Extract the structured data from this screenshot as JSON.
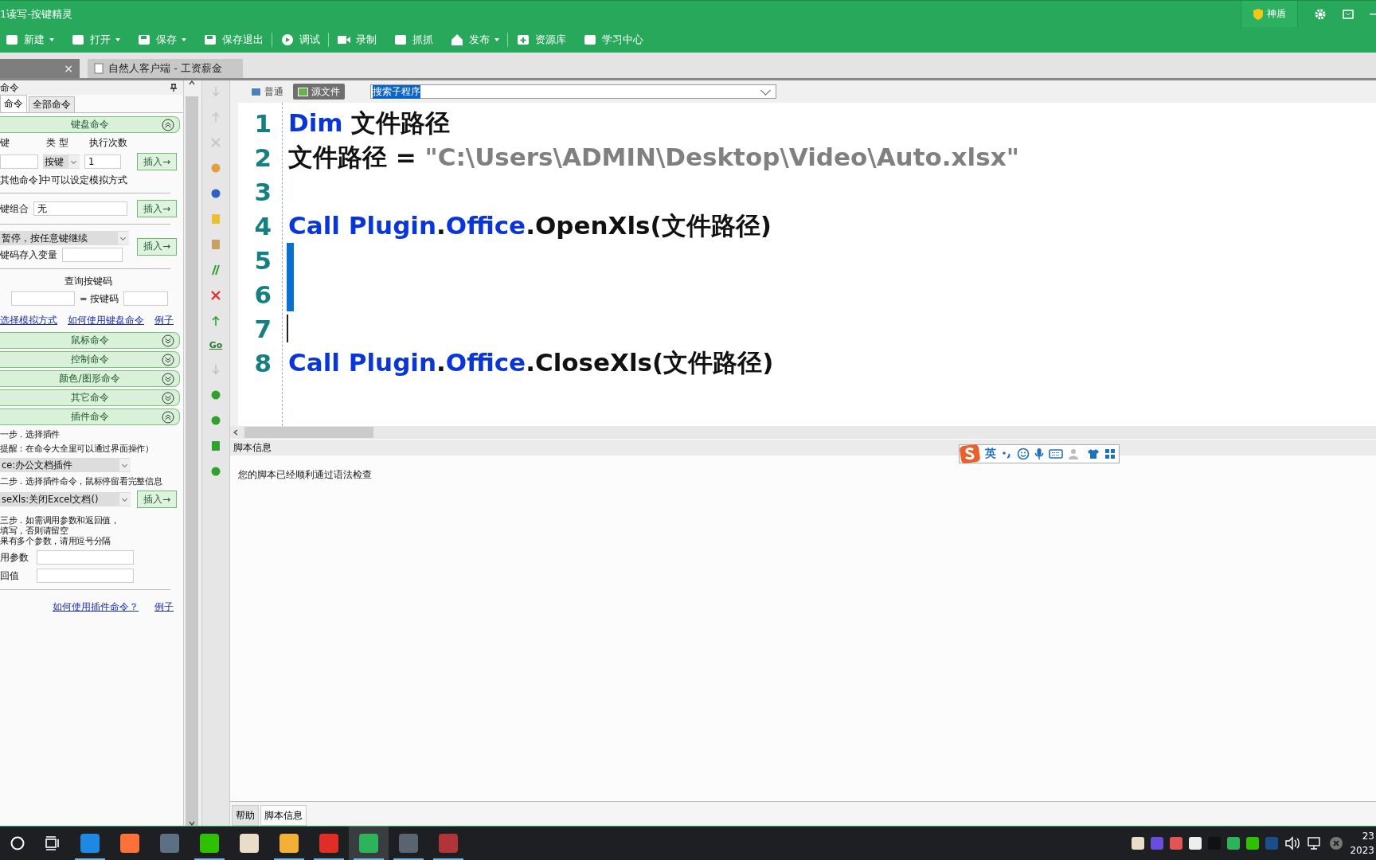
{
  "window": {
    "title": "1读写-按键精灵",
    "badge": "神盾"
  },
  "toolbar": [
    {
      "label": "新建",
      "dropdown": true,
      "separator_after": false
    },
    {
      "label": "打开",
      "dropdown": true,
      "separator_after": false
    },
    {
      "label": "保存",
      "dropdown": true,
      "separator_after": false
    },
    {
      "label": "保存退出",
      "dropdown": false,
      "separator_after": true
    },
    {
      "label": "调试",
      "dropdown": false,
      "separator_after": true
    },
    {
      "label": "录制",
      "dropdown": false,
      "separator_after": false
    },
    {
      "label": "抓抓",
      "dropdown": false,
      "separator_after": false
    },
    {
      "label": "发布",
      "dropdown": true,
      "separator_after": true
    },
    {
      "label": "资源库",
      "dropdown": false,
      "separator_after": false
    },
    {
      "label": "学习中心",
      "dropdown": false,
      "separator_after": false
    }
  ],
  "doc_tabs": [
    {
      "close": "×",
      "selected": true
    },
    {
      "label": "自然人客户端 - 工资薪金",
      "selected": false
    }
  ],
  "command_panel": {
    "title": "命令",
    "tabs": [
      {
        "label": "命令",
        "selected": true
      },
      {
        "label": "全部命令",
        "selected": false
      }
    ],
    "sections": [
      {
        "title": "键盘命令",
        "expanded": true,
        "kind": "keyboard"
      },
      {
        "title": "鼠标命令",
        "expanded": false,
        "kind": "plain"
      },
      {
        "title": "控制命令",
        "expanded": false,
        "kind": "plain"
      },
      {
        "title": "颜色/图形命令",
        "expanded": false,
        "kind": "plain"
      },
      {
        "title": "其它命令",
        "expanded": false,
        "kind": "plain"
      },
      {
        "title": "插件命令",
        "expanded": true,
        "kind": "plugin"
      }
    ],
    "keyboard": {
      "key_label": "键",
      "type_label": "类 型",
      "count_label": "执行次数",
      "type_value": "按键",
      "count_value": "1",
      "insert_1": "插入→",
      "note": "其他命令]中可以设定模拟方式",
      "combo_label": "键组合",
      "combo_value": "无",
      "insert_2": "插入→",
      "wait_value": "暂停，按任意键继续",
      "store_label": "键码存入变量",
      "insert_3": "插入→",
      "query_title": "查询按键码",
      "query_eq": "= 按键码",
      "links": [
        "选择模拟方式",
        "如何使用键盘命令",
        "例子"
      ]
    },
    "plugin": {
      "step_1": "一步．选择插件",
      "hint": "提醒：在命令大全里可以通过界面操作）",
      "plugin_value": "ce:办公文档插件",
      "step_2": "二步．选择插件命令，鼠标停留看完整信息",
      "command_value": "seXls:关闭Excel文档()",
      "insert": "插入→",
      "step_3": [
        "三步．如需调用参数和返回值，",
        "填写，否则请留空",
        "果有多个参数，请用逗号分隔"
      ],
      "params_label": "用参数",
      "return_label": "回值",
      "links": [
        "如何使用插件命令？",
        "例子"
      ]
    }
  },
  "editor": {
    "view_tabs": [
      {
        "label": "普通",
        "selected": false
      },
      {
        "label": "源文件",
        "selected": true
      }
    ],
    "subroutine_search": "搜索子程序",
    "lines": [
      {
        "number": "1",
        "marker": false,
        "cursor": false,
        "tokens": [
          {
            "text": "Dim",
            "kind": "keyword"
          },
          {
            "text": " 文件路径",
            "kind": "plain"
          }
        ]
      },
      {
        "number": "2",
        "marker": false,
        "cursor": false,
        "tokens": [
          {
            "text": "文件路径 = ",
            "kind": "plain"
          },
          {
            "text": "\"C:\\Users\\ADMIN\\Desktop\\Video\\Auto.xlsx\"",
            "kind": "string"
          }
        ]
      },
      {
        "number": "3",
        "marker": false,
        "cursor": false
      },
      {
        "number": "4",
        "marker": false,
        "cursor": false,
        "tokens": [
          {
            "text": "Call Plugin",
            "kind": "keyword"
          },
          {
            "text": ".",
            "kind": "plain"
          },
          {
            "text": "Office",
            "kind": "keyword"
          },
          {
            "text": ".OpenXls(文件路径)",
            "kind": "plain"
          }
        ]
      },
      {
        "number": "5",
        "marker": true,
        "cursor": false
      },
      {
        "number": "6",
        "marker": true,
        "cursor": false
      },
      {
        "number": "7",
        "marker": false,
        "cursor": true
      },
      {
        "number": "8",
        "marker": false,
        "cursor": false,
        "tokens": [
          {
            "text": "Call Plugin",
            "kind": "keyword"
          },
          {
            "text": ".",
            "kind": "plain"
          },
          {
            "text": "Office",
            "kind": "keyword"
          },
          {
            "text": ".CloseXls(文件路径)",
            "kind": "plain"
          }
        ]
      }
    ]
  },
  "output": {
    "title": "脚本信息",
    "message": "您的脚本已经顺利通过语法检查",
    "tabs": [
      {
        "label": "帮助",
        "selected": false
      },
      {
        "label": "脚本信息",
        "selected": true
      }
    ]
  },
  "ime_bar": {
    "mode": "英"
  },
  "taskbar": {
    "apps": [
      {
        "color": "#1e88e5",
        "running": true,
        "selected": false
      },
      {
        "color": "#ff7139",
        "running": false,
        "selected": false
      },
      {
        "color": "#5b6f85",
        "running": false,
        "selected": false
      },
      {
        "color": "#2dc100",
        "running": true,
        "selected": false
      },
      {
        "color": "#e9dcc9",
        "running": false,
        "selected": false
      },
      {
        "color": "#f2b134",
        "running": true,
        "selected": false
      },
      {
        "color": "#e02e24",
        "running": true,
        "selected": false
      },
      {
        "color": "#2bb45a",
        "running": true,
        "selected": true
      },
      {
        "color": "#5a6470",
        "running": true,
        "selected": false
      },
      {
        "color": "#b0343a",
        "running": true,
        "selected": false
      }
    ],
    "tray": [
      {
        "color": "#e9dcc9"
      },
      {
        "color": "#6a4cdf"
      },
      {
        "color": "#e05555"
      },
      {
        "color": "#eeeeee"
      },
      {
        "color": "#111111"
      },
      {
        "color": "#2bb45a"
      },
      {
        "color": "#2dc100"
      },
      {
        "color": "#1b4f8a"
      }
    ],
    "clock": [
      "23",
      "2023"
    ]
  },
  "side_toolbar": {
    "goto": "Go"
  }
}
